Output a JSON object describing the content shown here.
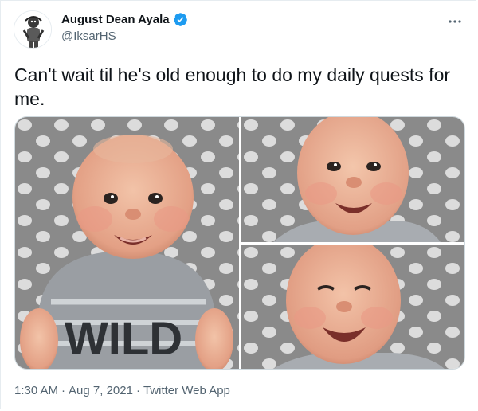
{
  "author": {
    "display_name": "August Dean Ayala",
    "handle": "@IksarHS",
    "verified_icon": "verified-badge-icon",
    "verified_color": "#1d9bf0"
  },
  "tweet": {
    "text": "Can't wait til he's old enough to do my daily quests for me."
  },
  "media": {
    "photos": [
      {
        "name": "baby-in-wild-onesie-photo"
      },
      {
        "name": "baby-smiling-closeup-photo"
      },
      {
        "name": "baby-laughing-closeup-photo"
      }
    ]
  },
  "footer": {
    "time": "1:30 AM",
    "separator": "·",
    "date": "Aug 7, 2021",
    "source": "Twitter Web App"
  },
  "colors": {
    "text_primary": "#0f1419",
    "text_secondary": "#536471",
    "background_pattern": "#8f8f8f"
  }
}
